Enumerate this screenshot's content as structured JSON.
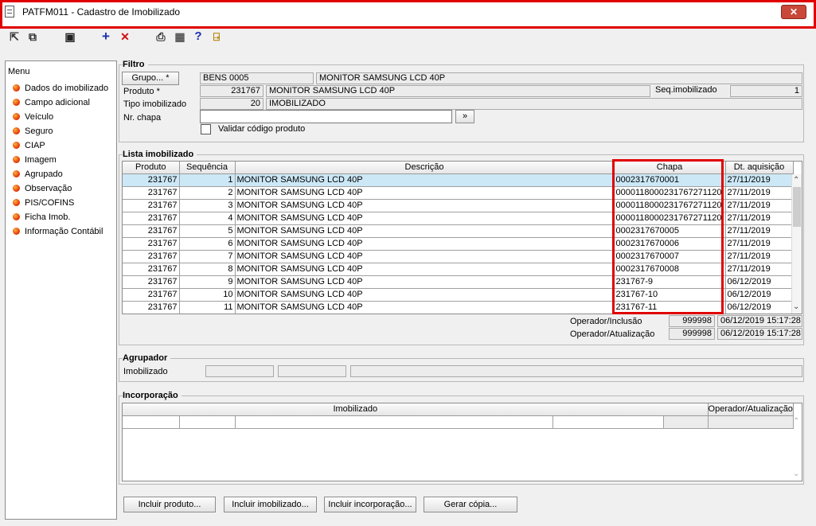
{
  "window": {
    "title": "PATFM011 - Cadastro de Imobilizado",
    "close_symbol": "✕"
  },
  "toolbar": {
    "tools": [
      {
        "name": "first-record-icon",
        "glyph": "⇱"
      },
      {
        "name": "copy-records-icon",
        "glyph": "⧉"
      },
      {
        "name": "save-icon",
        "glyph": "▣"
      },
      {
        "name": "add-icon",
        "glyph": "+"
      },
      {
        "name": "delete-icon",
        "glyph": "✕"
      },
      {
        "name": "print-icon",
        "glyph": "⎙"
      },
      {
        "name": "grid-icon",
        "glyph": "▦"
      },
      {
        "name": "help-icon",
        "glyph": "?"
      },
      {
        "name": "exit-icon",
        "glyph": "⍈"
      }
    ]
  },
  "menu": {
    "title": "Menu",
    "items": [
      "Dados do imobilizado",
      "Campo adicional",
      "Veículo",
      "Seguro",
      "CIAP",
      "Imagem",
      "Agrupado",
      "Observação",
      "PIS/COFINS",
      "Ficha Imob.",
      "Informação Contábil"
    ]
  },
  "filtro": {
    "label": "Filtro",
    "grupo_button": "Grupo... *",
    "grupo_code": "BENS 0005",
    "grupo_desc": "MONITOR SAMSUNG LCD 40P",
    "produto_label": "Produto *",
    "produto_code": "231767",
    "produto_desc": "MONITOR SAMSUNG LCD 40P",
    "seq_label": "Seq.imobilizado",
    "seq_value": "1",
    "tipo_label": "Tipo imobilizado",
    "tipo_code": "20",
    "tipo_desc": "IMOBILIZADO",
    "chapa_label": "Nr. chapa",
    "chapa_value": "",
    "go_button": "»",
    "validar_label": "Validar código produto"
  },
  "lista": {
    "label": "Lista imobilizado",
    "columns": [
      "Produto",
      "Sequência",
      "Descrição",
      "Chapa",
      "Dt. aquisição"
    ],
    "rows": [
      [
        "231767",
        "1",
        "MONITOR SAMSUNG LCD 40P",
        "0002317670001",
        "27/11/2019"
      ],
      [
        "231767",
        "2",
        "MONITOR SAMSUNG LCD 40P",
        "0000118000231767271120",
        "27/11/2019"
      ],
      [
        "231767",
        "3",
        "MONITOR SAMSUNG LCD 40P",
        "0000118000231767271120",
        "27/11/2019"
      ],
      [
        "231767",
        "4",
        "MONITOR SAMSUNG LCD 40P",
        "0000118000231767271120",
        "27/11/2019"
      ],
      [
        "231767",
        "5",
        "MONITOR SAMSUNG LCD 40P",
        "0002317670005",
        "27/11/2019"
      ],
      [
        "231767",
        "6",
        "MONITOR SAMSUNG LCD 40P",
        "0002317670006",
        "27/11/2019"
      ],
      [
        "231767",
        "7",
        "MONITOR SAMSUNG LCD 40P",
        "0002317670007",
        "27/11/2019"
      ],
      [
        "231767",
        "8",
        "MONITOR SAMSUNG LCD 40P",
        "0002317670008",
        "27/11/2019"
      ],
      [
        "231767",
        "9",
        "MONITOR SAMSUNG LCD 40P",
        "231767-9",
        "06/12/2019"
      ],
      [
        "231767",
        "10",
        "MONITOR SAMSUNG LCD 40P",
        "231767-10",
        "06/12/2019"
      ],
      [
        "231767",
        "11",
        "MONITOR SAMSUNG LCD 40P",
        "231767-11",
        "06/12/2019"
      ]
    ],
    "operador_inclusao_label": "Operador/Inclusão",
    "operador_inclusao_id": "999998",
    "operador_inclusao_date": "06/12/2019 15:17:28",
    "operador_atualizacao_label": "Operador/Atualização",
    "operador_atualizacao_id": "999998",
    "operador_atualizacao_date": "06/12/2019 15:17:28"
  },
  "agrupador": {
    "label": "Agrupador",
    "imobilizado_label": "Imobilizado"
  },
  "incorporacao": {
    "label": "Incorporação",
    "col_imobilizado": "Imobilizado",
    "col_operador": "Operador/Atualização"
  },
  "buttons": {
    "incluir_produto": "Incluir produto...",
    "incluir_imobilizado": "Incluir imobilizado...",
    "incluir_incorporacao": "Incluir incorporação...",
    "gerar_copia": "Gerar cópia..."
  },
  "colors": {
    "highlight": "#e00000",
    "selected_row": "#cce8f7"
  }
}
